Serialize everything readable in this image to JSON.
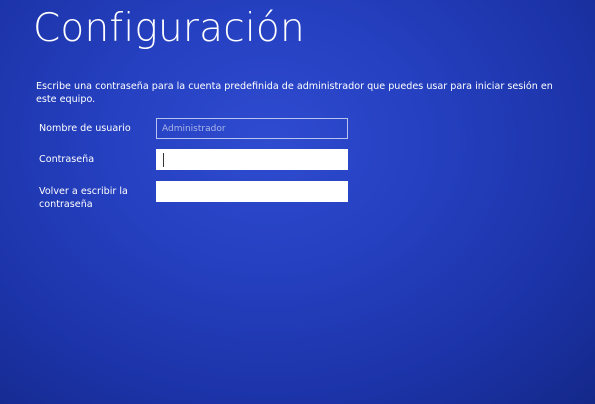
{
  "page": {
    "title": "Configuración",
    "description": "Escribe una contraseña para la cuenta predefinida de administrador que puedes usar para iniciar sesión en este equipo."
  },
  "form": {
    "username": {
      "label": "Nombre de usuario",
      "value": "Administrador"
    },
    "password": {
      "label": "Contraseña",
      "value": ""
    },
    "password_confirm": {
      "label": "Volver a escribir la contraseña",
      "value": ""
    }
  },
  "colors": {
    "background": "#2540c0",
    "text": "#ffffff",
    "readonly_border": "#b9c4ee"
  }
}
